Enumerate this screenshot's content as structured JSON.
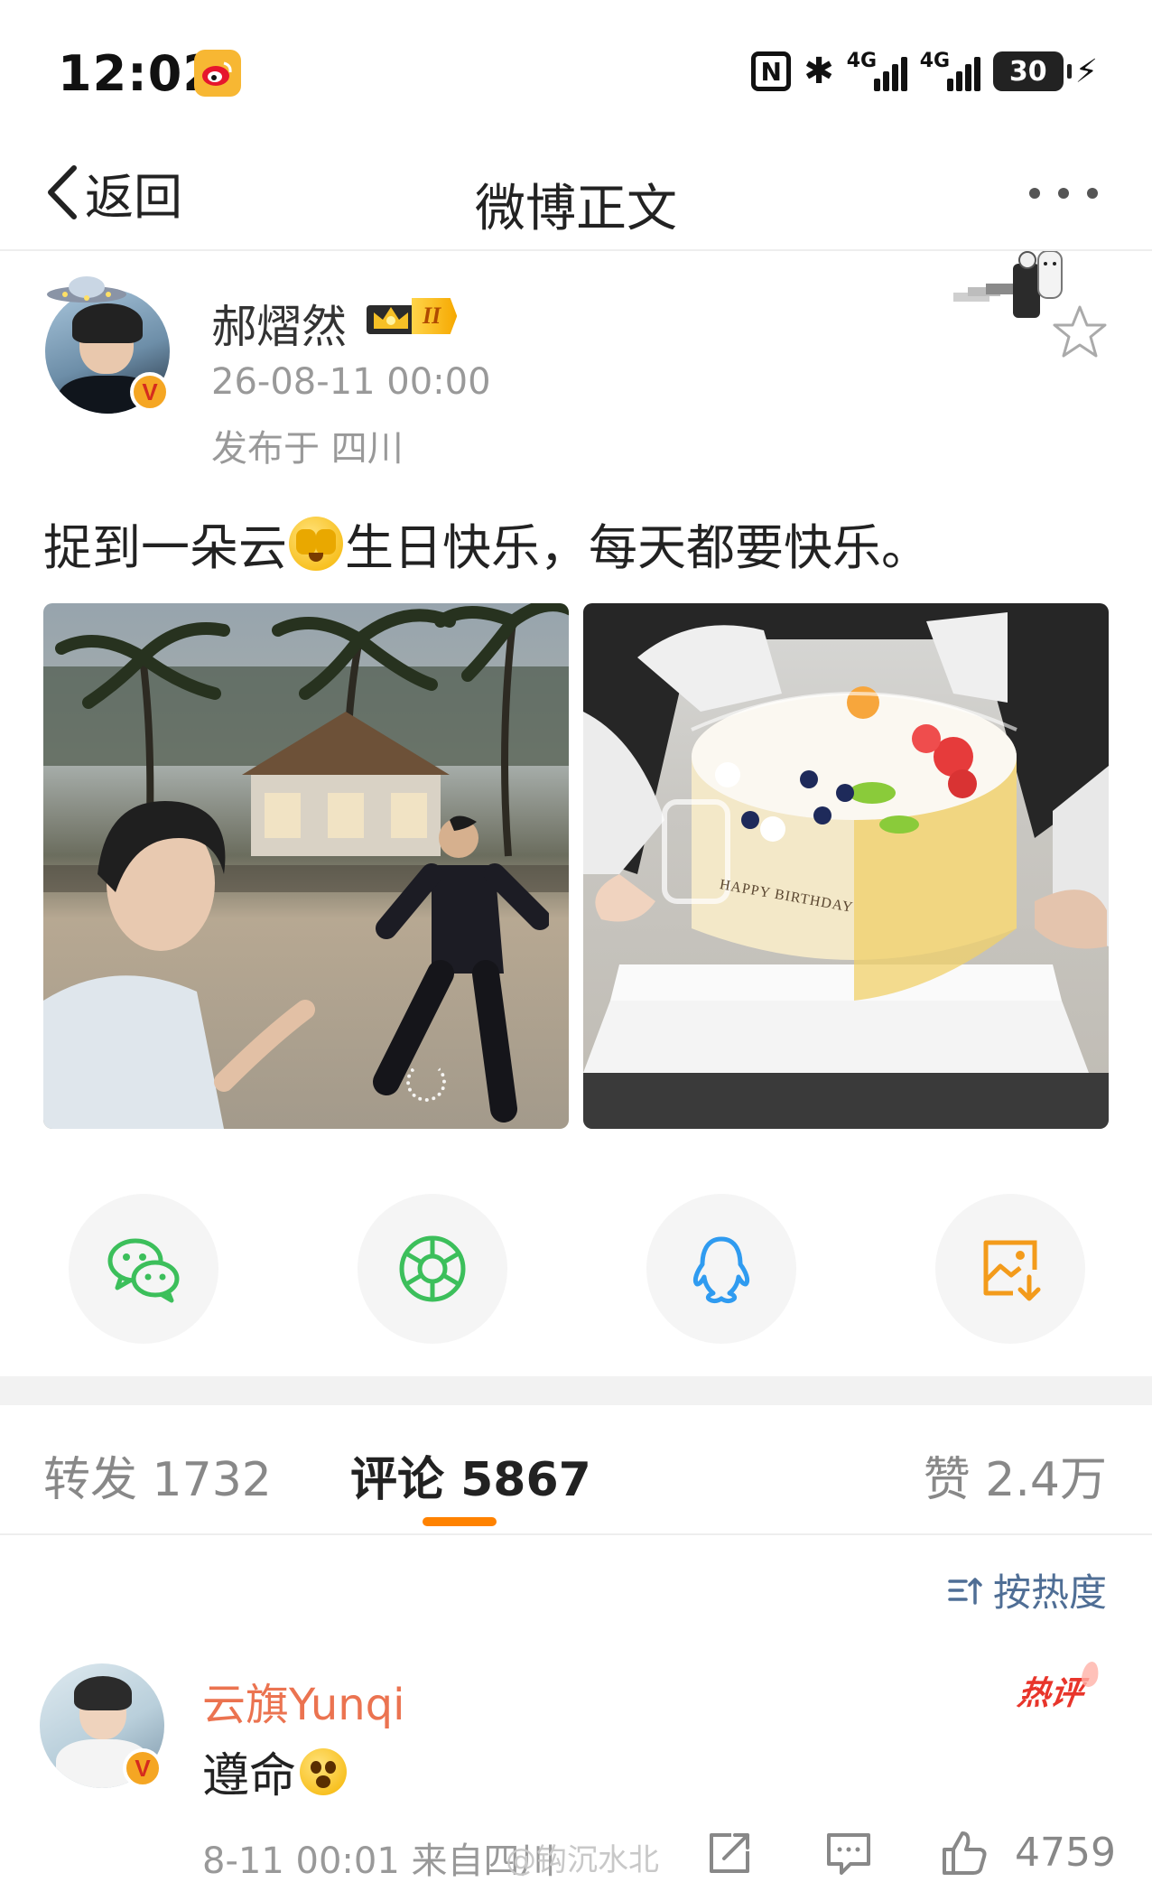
{
  "status_bar": {
    "time": "12:02",
    "nfc": "N",
    "network_1": "4G",
    "network_2": "4G",
    "battery": "30"
  },
  "nav": {
    "back_label": "返回",
    "title": "微博正文"
  },
  "post": {
    "author": "郝熠然",
    "vip_level": "II",
    "timestamp": "26-08-11 00:00",
    "location": "发布于 四川",
    "text_part1": "捉到一朵云",
    "text_part2": "生日快乐，每天都要快乐。",
    "photo_caption_cake": "HAPPY BIRTHDAY"
  },
  "tabs": {
    "repost": "转发 1732",
    "comments": "评论 5867",
    "likes": "赞 2.4万"
  },
  "sort": {
    "label": "按热度"
  },
  "comment": {
    "author": "云旗Yunqi",
    "hot_badge": "热评",
    "text": "遵命",
    "meta": "8-11 00:01 来自四川",
    "watermark": "@钩沉水北",
    "likes": "4759"
  },
  "colors": {
    "accent_orange": "#ff8200",
    "comment_author": "#eb7350",
    "sort_blue": "#4f6e95",
    "wechat_green": "#3cbf5b",
    "qq_blue": "#2f9bf0",
    "save_orange": "#f39b1b"
  },
  "icons": {
    "share_row": [
      "wechat-icon",
      "moments-icon",
      "qq-icon",
      "save-image-icon"
    ],
    "comment_actions": [
      "share-icon",
      "reply-icon",
      "like-icon"
    ]
  }
}
